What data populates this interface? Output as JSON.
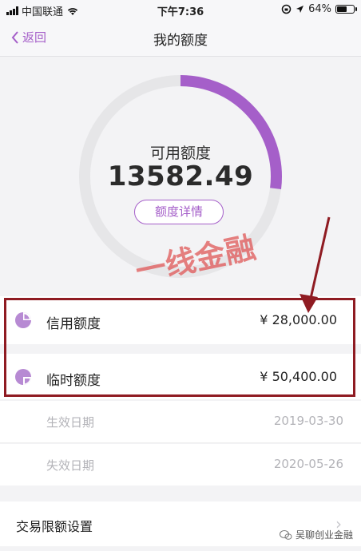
{
  "status_bar": {
    "carrier": "中国联通",
    "time": "下午7:36",
    "battery": "64%",
    "battery_level": 0.64
  },
  "nav": {
    "back_label": "返回",
    "title": "我的额度"
  },
  "ring": {
    "label": "可用额度",
    "amount": "13582.49",
    "detail_button": "额度详情",
    "used_fraction": 0.27,
    "accent_color": "#a55fc9"
  },
  "watermark_text": "一线金融",
  "rows": [
    {
      "label": "信用额度",
      "amount": "¥ 28,000.00"
    },
    {
      "label": "临时额度",
      "amount": "¥ 50,400.00"
    }
  ],
  "dates": [
    {
      "label": "生效日期",
      "value": "2019-03-30"
    },
    {
      "label": "失效日期",
      "value": "2020-05-26"
    }
  ],
  "settings": {
    "label": "交易限额设置"
  },
  "footer": {
    "account": "吴聊创业金融"
  }
}
